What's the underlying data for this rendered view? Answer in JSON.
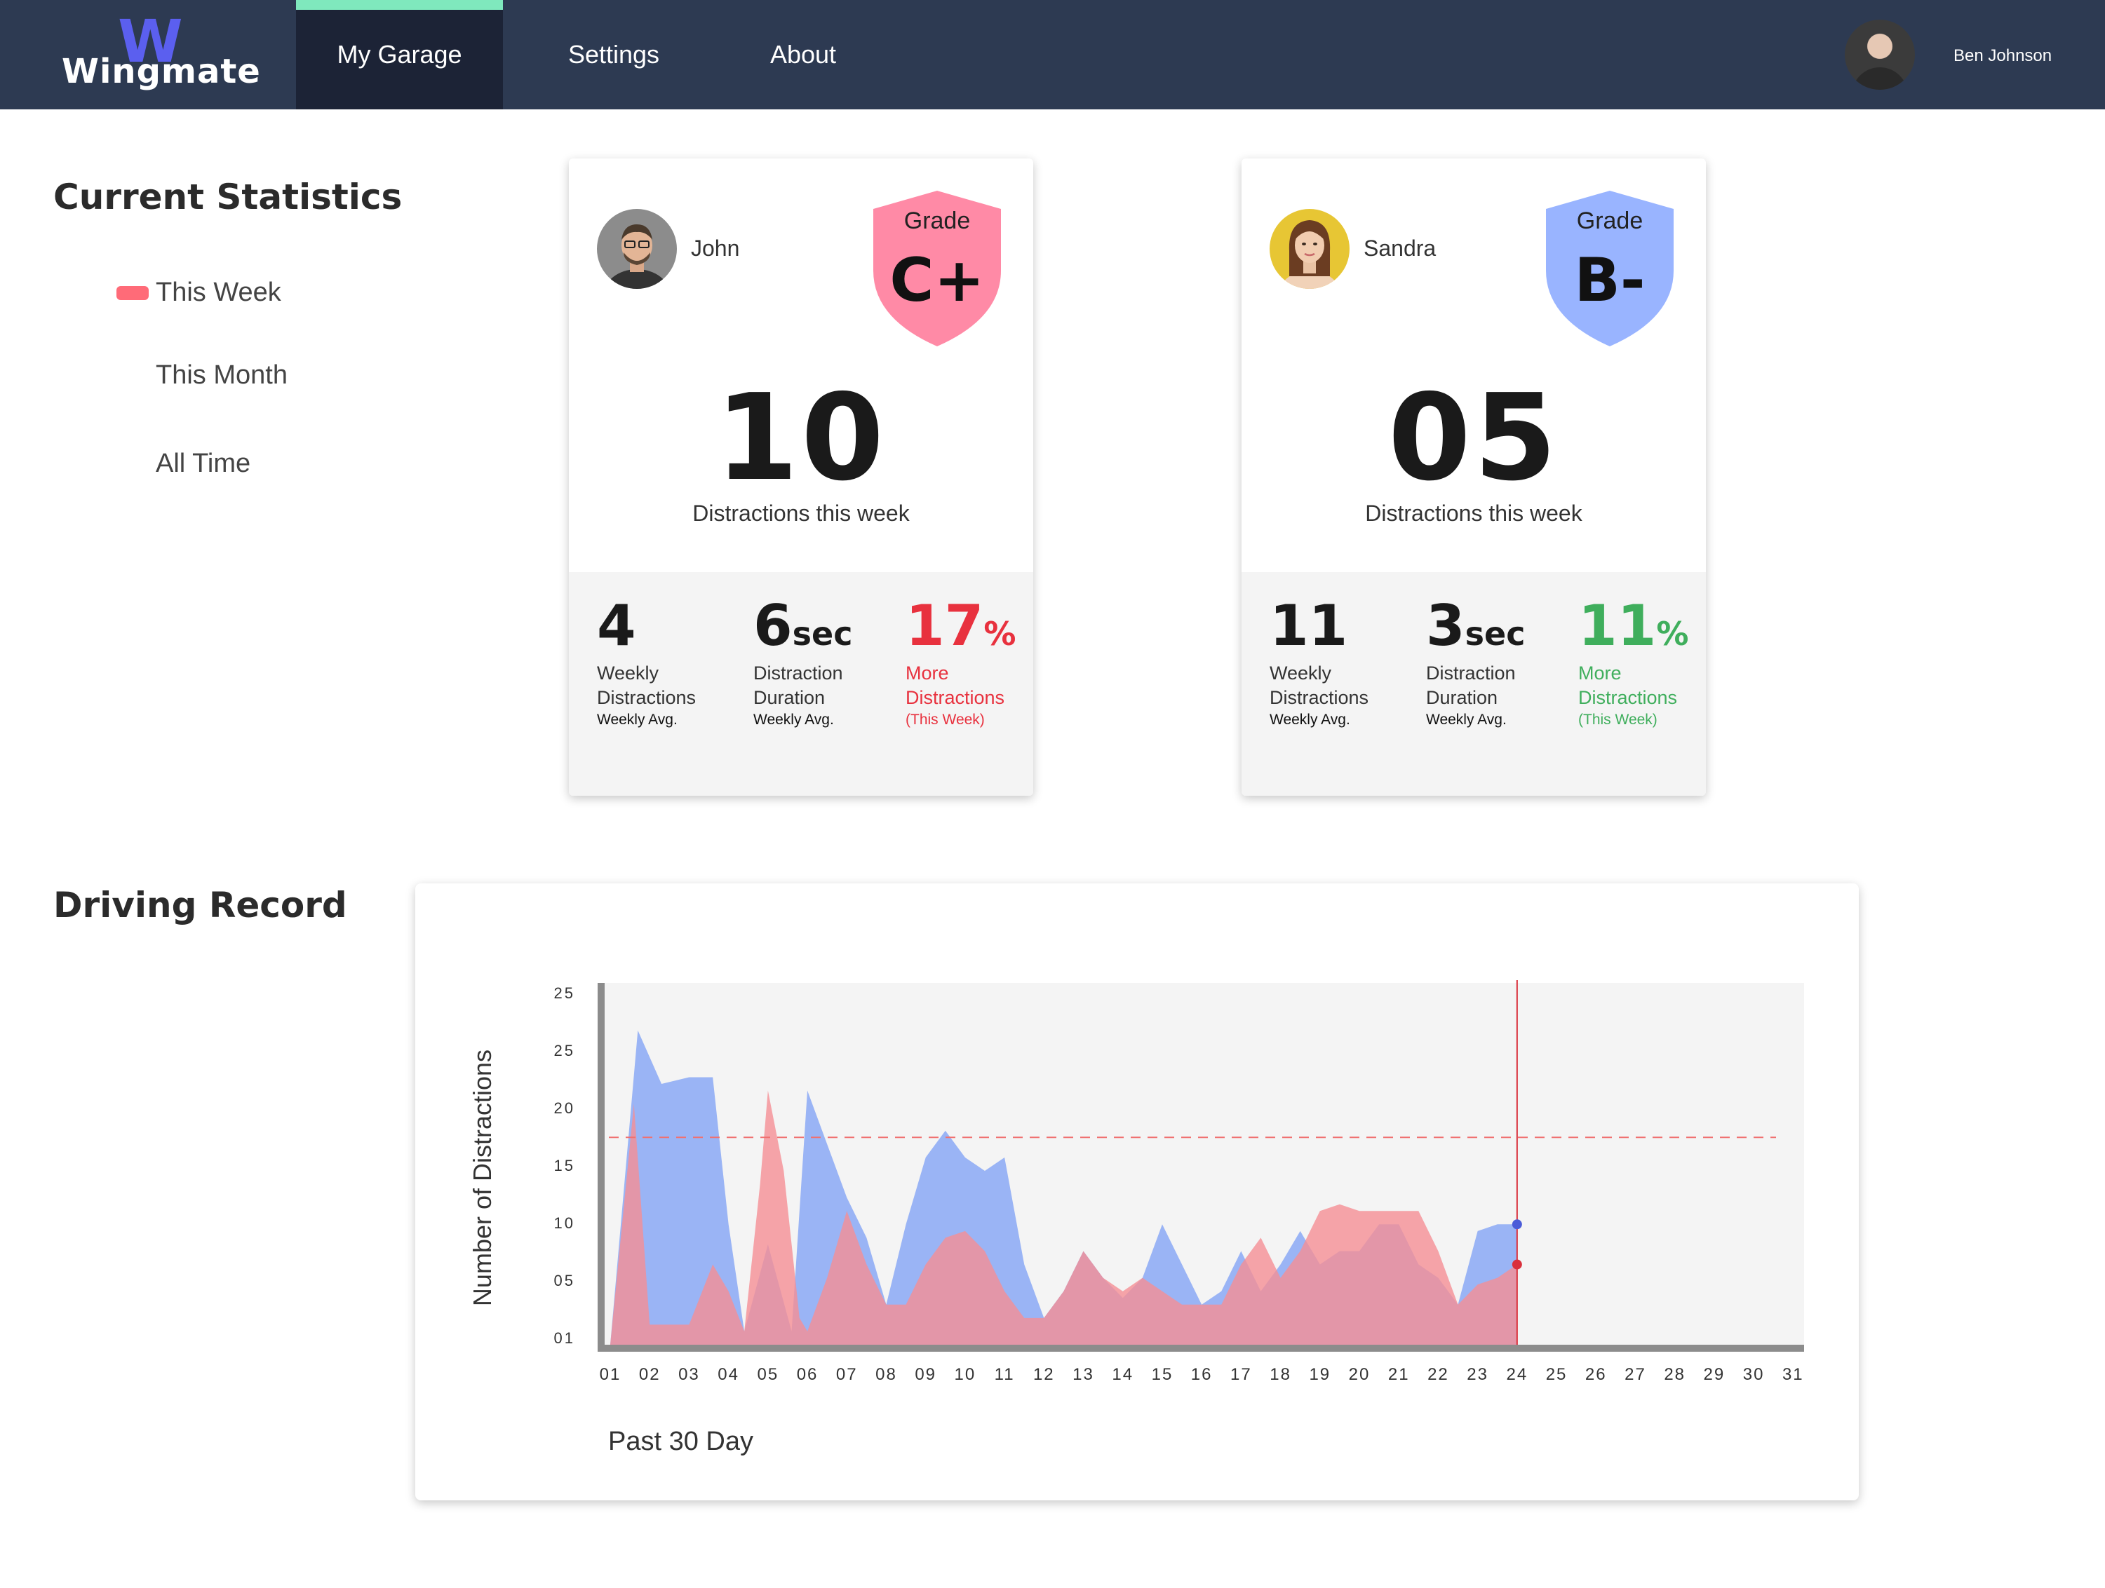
{
  "app": {
    "logo_mark": "W",
    "logo_text": "Wingmate",
    "nav": [
      "My Garage",
      "Settings",
      "About"
    ],
    "active_nav": "My Garage",
    "user_name": "Ben Johnson"
  },
  "stats_section": {
    "title": "Current Statistics",
    "periods": [
      "This Week",
      "This Month",
      "All Time"
    ],
    "active_period": "This Week"
  },
  "drivers": [
    {
      "name": "John",
      "grade_label": "Grade",
      "grade": "C+",
      "grade_color": "#ff8aa6",
      "count": "10",
      "count_caption": "Distractions this week",
      "weekly": {
        "value": "4",
        "l1": "Weekly",
        "l2": "Distractions",
        "l3": "Weekly Avg."
      },
      "duration": {
        "value": "6",
        "unit": "sec",
        "l1": "Distraction",
        "l2": "Duration",
        "l3": "Weekly Avg."
      },
      "change": {
        "value": "17",
        "unit": "%",
        "l1": "More",
        "l2": "Distractions",
        "l3": "(This Week)",
        "color": "#e8313e"
      }
    },
    {
      "name": "Sandra",
      "grade_label": "Grade",
      "grade": "B-",
      "grade_color": "#99b4ff",
      "count": "05",
      "count_caption": "Distractions this week",
      "weekly": {
        "value": "11",
        "l1": "Weekly",
        "l2": "Distractions",
        "l3": "Weekly Avg."
      },
      "duration": {
        "value": "3",
        "unit": "sec",
        "l1": "Distraction",
        "l2": "Duration",
        "l3": "Weekly Avg."
      },
      "change": {
        "value": "11",
        "unit": "%",
        "l1": "More",
        "l2": "Distractions",
        "l3": "(This Week)",
        "color": "#3fae5c"
      }
    }
  ],
  "record_section": {
    "title": "Driving Record",
    "caption": "Past 30 Day"
  },
  "chart_data": {
    "type": "area",
    "ylabel": "Number of Distractions",
    "xlabel": "Past 30 Day",
    "y_tick_labels": [
      "01",
      "05",
      "10",
      "15",
      "20",
      "25",
      "25"
    ],
    "ylim": [
      0,
      26
    ],
    "x_tick_labels": [
      "01",
      "02",
      "03",
      "04",
      "05",
      "06",
      "07",
      "08",
      "09",
      "10",
      "11",
      "12",
      "13",
      "14",
      "15",
      "16",
      "17",
      "18",
      "19",
      "20",
      "21",
      "22",
      "23",
      "24",
      "25",
      "26",
      "27",
      "28",
      "29",
      "30",
      "31"
    ],
    "threshold": 15.5,
    "threshold_color": "#f07070",
    "current_day_marker": 24,
    "grid": false,
    "series": [
      {
        "color": "#8aa8f5",
        "points": [
          [
            1,
            0
          ],
          [
            1.7,
            23.5
          ],
          [
            2.3,
            19.5
          ],
          [
            3,
            20
          ],
          [
            3.6,
            20
          ],
          [
            4,
            9
          ],
          [
            4.4,
            1
          ],
          [
            5,
            7.5
          ],
          [
            5.6,
            1
          ],
          [
            6,
            19
          ],
          [
            6.5,
            15
          ],
          [
            7,
            11
          ],
          [
            7.5,
            8
          ],
          [
            8,
            3
          ],
          [
            8.5,
            9
          ],
          [
            9,
            14
          ],
          [
            9.5,
            16
          ],
          [
            10,
            14
          ],
          [
            10.5,
            13
          ],
          [
            11,
            14
          ],
          [
            11.5,
            6
          ],
          [
            12,
            2
          ],
          [
            12.5,
            4
          ],
          [
            13,
            7
          ],
          [
            13.5,
            5
          ],
          [
            14,
            3.5
          ],
          [
            14.5,
            5
          ],
          [
            15,
            9
          ],
          [
            15.5,
            6
          ],
          [
            16,
            3
          ],
          [
            16.5,
            4
          ],
          [
            17,
            7
          ],
          [
            17.5,
            4
          ],
          [
            18,
            6
          ],
          [
            18.5,
            8.5
          ],
          [
            19,
            6
          ],
          [
            19.5,
            7
          ],
          [
            20,
            7
          ],
          [
            20.5,
            9
          ],
          [
            21,
            9
          ],
          [
            21.5,
            6
          ],
          [
            22,
            5
          ],
          [
            22.5,
            3
          ],
          [
            23,
            8.5
          ],
          [
            23.5,
            9
          ],
          [
            24,
            9
          ]
        ]
      },
      {
        "color": "#f58f95",
        "points": [
          [
            1,
            0
          ],
          [
            1.6,
            18
          ],
          [
            2,
            1.5
          ],
          [
            2.5,
            1.5
          ],
          [
            3,
            1.5
          ],
          [
            3.6,
            6
          ],
          [
            4,
            4
          ],
          [
            4.4,
            1
          ],
          [
            4.8,
            12
          ],
          [
            5,
            19
          ],
          [
            5.4,
            13
          ],
          [
            5.8,
            2
          ],
          [
            6,
            1
          ],
          [
            6.5,
            5
          ],
          [
            7,
            10
          ],
          [
            7.5,
            6
          ],
          [
            8,
            3
          ],
          [
            8.5,
            3
          ],
          [
            9,
            6
          ],
          [
            9.5,
            8
          ],
          [
            10,
            8.5
          ],
          [
            10.5,
            7
          ],
          [
            11,
            4
          ],
          [
            11.5,
            2
          ],
          [
            12,
            2
          ],
          [
            12.5,
            4
          ],
          [
            13,
            7
          ],
          [
            13.5,
            5
          ],
          [
            14,
            4
          ],
          [
            14.5,
            5
          ],
          [
            15,
            4
          ],
          [
            15.5,
            3
          ],
          [
            16,
            3
          ],
          [
            16.5,
            3
          ],
          [
            17,
            6
          ],
          [
            17.5,
            8
          ],
          [
            18,
            5
          ],
          [
            18.5,
            7
          ],
          [
            19,
            10
          ],
          [
            19.5,
            10.5
          ],
          [
            20,
            10
          ],
          [
            20.5,
            10
          ],
          [
            21,
            10
          ],
          [
            21.5,
            10
          ],
          [
            22,
            7
          ],
          [
            22.5,
            3
          ],
          [
            23,
            4.5
          ],
          [
            23.5,
            5
          ],
          [
            24,
            6
          ]
        ]
      }
    ]
  }
}
